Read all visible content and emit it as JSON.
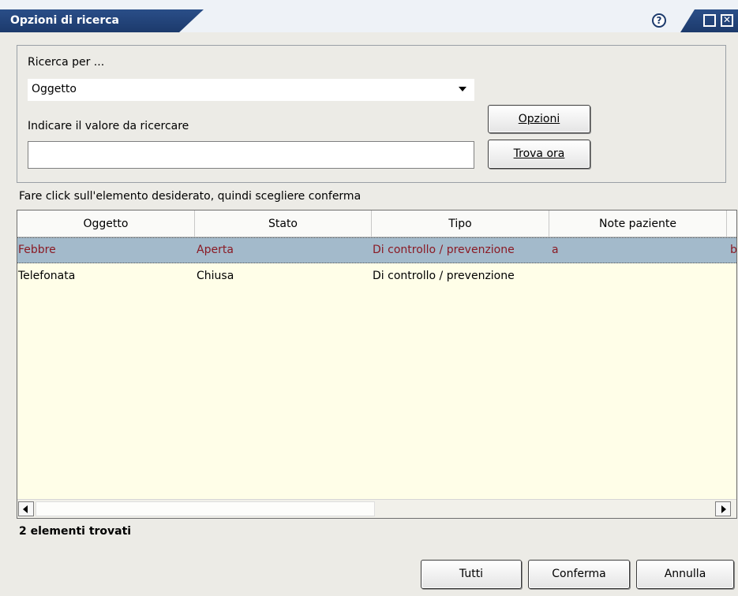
{
  "window": {
    "title": "Opzioni di ricerca",
    "help_label": "?",
    "icons": [
      "help-icon",
      "maximize-icon",
      "close-icon"
    ]
  },
  "search": {
    "search_by_label": "Ricerca per ...",
    "search_by_value": "Oggetto",
    "value_label": "Indicare il valore da ricercare",
    "value": "",
    "options_button": "Opzioni",
    "find_now_button": "Trova ora"
  },
  "instructions": "Fare click sull'elemento desiderato, quindi scegliere conferma",
  "table": {
    "columns": [
      "Oggetto",
      "Stato",
      "Tipo",
      "Note paziente"
    ],
    "rows": [
      {
        "oggetto": "Febbre",
        "stato": "Aperta",
        "tipo": "Di controllo / prevenzione",
        "note": "a",
        "extra": "b",
        "selected": true
      },
      {
        "oggetto": "Telefonata",
        "stato": "Chiusa",
        "tipo": "Di controllo / prevenzione",
        "note": "",
        "extra": "",
        "selected": false
      }
    ]
  },
  "status": {
    "result_count": "2 elementi trovati"
  },
  "footer": {
    "all_button": "Tutti",
    "confirm_button": "Conferma",
    "cancel_button": "Annulla"
  },
  "colors": {
    "title_bar": "#1c3a6c",
    "selected_row_bg": "#a3bacb",
    "selected_row_text": "#8a1a24",
    "table_bg": "#fffee8"
  }
}
